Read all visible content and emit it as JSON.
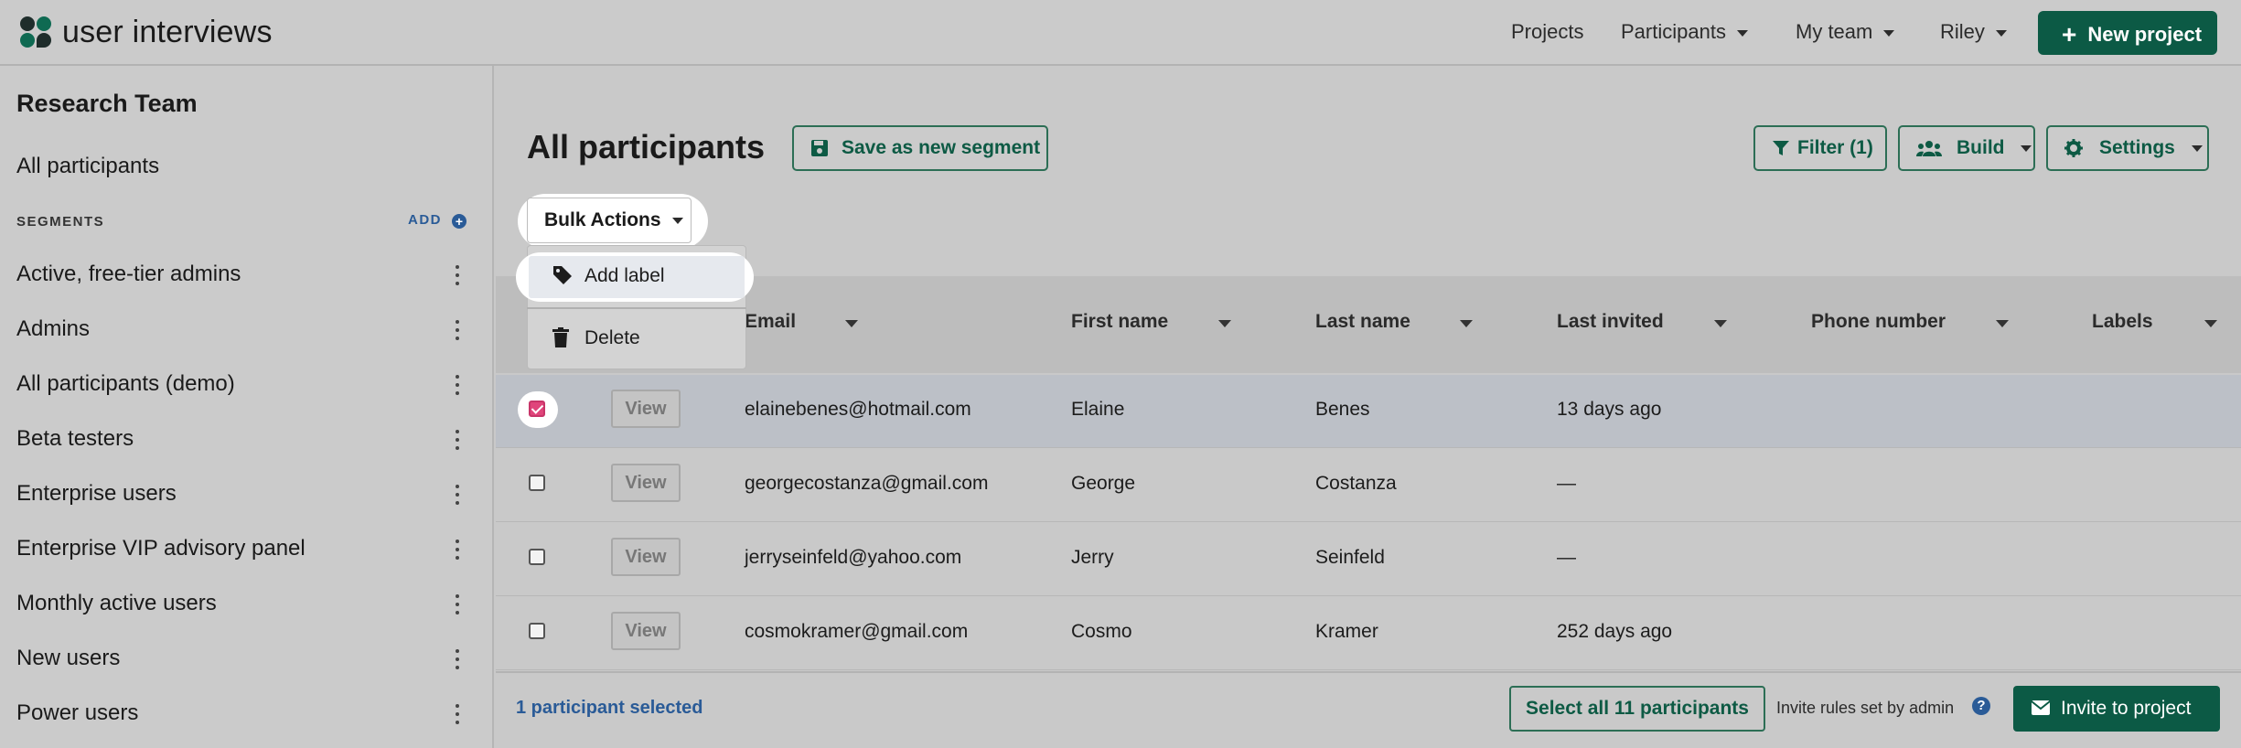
{
  "brand": {
    "name": "user interviews"
  },
  "nav": {
    "projects": "Projects",
    "participants": "Participants",
    "my_team": "My team",
    "user": "Riley",
    "new_project": "New project"
  },
  "sidebar": {
    "team": "Research Team",
    "all_participants": "All participants",
    "segments_heading": "SEGMENTS",
    "add_label": "ADD",
    "segments": [
      "Active, free-tier admins",
      "Admins",
      "All participants (demo)",
      "Beta testers",
      "Enterprise users",
      "Enterprise VIP advisory panel",
      "Monthly active users",
      "New users",
      "Power users"
    ]
  },
  "main": {
    "title": "All participants",
    "save_segment": "Save as new segment",
    "filter": "Filter (1)",
    "build": "Build",
    "settings": "Settings",
    "bulk_actions": "Bulk Actions",
    "menu": {
      "add_label": "Add label",
      "delete": "Delete"
    }
  },
  "table": {
    "columns": [
      "Email",
      "First name",
      "Last name",
      "Last invited",
      "Phone number",
      "Labels"
    ],
    "view_label": "View",
    "rows": [
      {
        "email": "elainebenes@hotmail.com",
        "first": "Elaine",
        "last": "Benes",
        "invited": "13 days ago",
        "phone": "",
        "labels": "",
        "checked": true
      },
      {
        "email": "georgecostanza@gmail.com",
        "first": "George",
        "last": "Costanza",
        "invited": "—",
        "phone": "",
        "labels": "",
        "checked": false
      },
      {
        "email": "jerryseinfeld@yahoo.com",
        "first": "Jerry",
        "last": "Seinfeld",
        "invited": "—",
        "phone": "",
        "labels": "",
        "checked": false
      },
      {
        "email": "cosmokramer@gmail.com",
        "first": "Cosmo",
        "last": "Kramer",
        "invited": "252 days ago",
        "phone": "",
        "labels": "",
        "checked": false
      }
    ]
  },
  "footer": {
    "selected": "1 participant selected",
    "select_all": "Select all 11 participants",
    "invite_rules": "Invite rules set by admin",
    "invite": "Invite to project"
  },
  "colors": {
    "brand_green": "#0c5a45",
    "link_blue": "#2a5b97",
    "checkbox_pink": "#e0457b"
  }
}
